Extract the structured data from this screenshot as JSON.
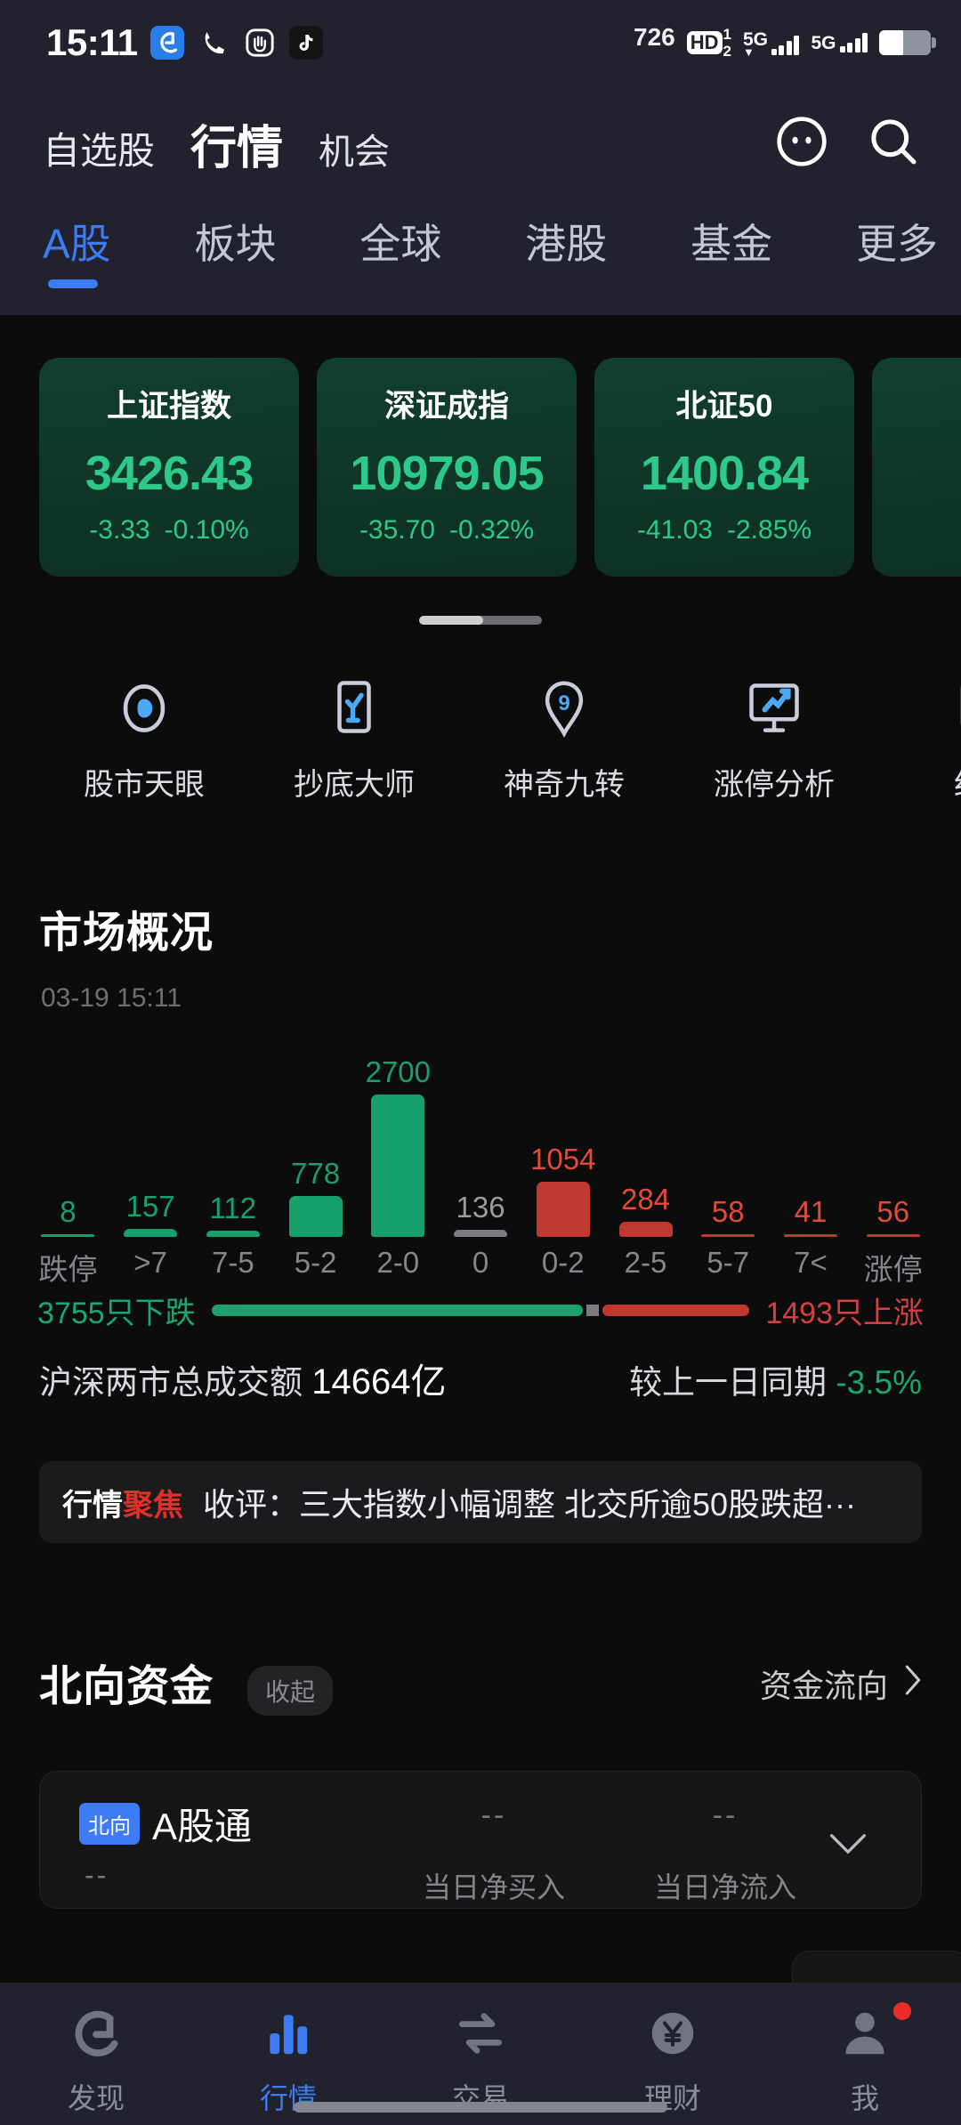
{
  "status_bar": {
    "time": "15:11",
    "app_icons": [
      "finance-app-icon",
      "phone-icon",
      "hand-icon",
      "tiktok-icon"
    ],
    "notification_count": "726",
    "hd_label": "HD",
    "sim1": "1",
    "sim2": "2",
    "network_1": "5G",
    "network_2": "5G"
  },
  "header": {
    "tabs": [
      {
        "label": "自选股",
        "selected": false
      },
      {
        "label": "行情",
        "selected": true
      },
      {
        "label": "机会",
        "selected": false
      }
    ],
    "icons": [
      "emoji-face-icon",
      "search-icon"
    ]
  },
  "category_tabs": [
    {
      "label": "A股",
      "active": true
    },
    {
      "label": "板块",
      "active": false
    },
    {
      "label": "全球",
      "active": false
    },
    {
      "label": "港股",
      "active": false
    },
    {
      "label": "基金",
      "active": false
    },
    {
      "label": "更多",
      "active": false
    }
  ],
  "index_cards": [
    {
      "name": "上证指数",
      "value": "3426.43",
      "change": "-3.33",
      "percent": "-0.10%"
    },
    {
      "name": "深证成指",
      "value": "10979.05",
      "change": "-35.70",
      "percent": "-0.32%"
    },
    {
      "name": "北证50",
      "value": "1400.84",
      "change": "-41.03",
      "percent": "-2.85%"
    }
  ],
  "quick_actions": [
    {
      "label": "股市天眼",
      "icon": "eye-compass-icon"
    },
    {
      "label": "抄底大师",
      "icon": "phone-check-icon"
    },
    {
      "label": "神奇九转",
      "icon": "pin-nine-icon"
    },
    {
      "label": "涨停分析",
      "icon": "monitor-arrow-icon"
    },
    {
      "label": "红绿",
      "icon": "up-arrow-box-icon"
    }
  ],
  "market_overview": {
    "title": "市场概况",
    "timestamp": "03-19 15:11",
    "decliners_text": "3755只下跌",
    "advancers_text": "1493只上涨",
    "decliners": 3755,
    "advancers": 1493,
    "turnover_label": "沪深两市总成交额",
    "turnover_value": "14664亿",
    "compare_label": "较上一日同期",
    "compare_value": "-3.5%"
  },
  "chart_data": {
    "type": "bar",
    "title": "市场概况",
    "subtitle": "03-19 15:11",
    "categories": [
      "跌停",
      ">7",
      "7-5",
      "5-2",
      "2-0",
      "0",
      "0-2",
      "2-5",
      "5-7",
      "7<",
      "涨停"
    ],
    "values": [
      8,
      157,
      112,
      778,
      2700,
      136,
      1054,
      284,
      58,
      41,
      56
    ],
    "bar_colors": [
      "#17a06c",
      "#17a06c",
      "#17a06c",
      "#17a06c",
      "#17a06c",
      "#7a7b80",
      "#c0392f",
      "#c0392f",
      "#c0392f",
      "#c0392f",
      "#c0392f"
    ],
    "label_colors": [
      "#17a06c",
      "#17a06c",
      "#17a06c",
      "#17a06c",
      "#17a06c",
      "#9a9b9f",
      "#e04b3d",
      "#e04b3d",
      "#e04b3d",
      "#e04b3d",
      "#e04b3d"
    ],
    "xlabel": "",
    "ylabel": "",
    "ylim": [
      0,
      2700
    ],
    "grid": false,
    "legend": "none"
  },
  "news": {
    "tag_white": "行情",
    "tag_red": "聚焦",
    "headline": "收评：三大指数小幅调整 北交所逾50股跌超···"
  },
  "northbound": {
    "title": "北向资金",
    "collapse_label": "收起",
    "flow_link": "资金流向",
    "card": {
      "badge": "北向",
      "name": "A股通",
      "value": "--",
      "sub_value": "--",
      "col1_value": "--",
      "col1_label": "当日净买入",
      "col2_value": "--",
      "col2_label": "当日净流入"
    }
  },
  "bottom_nav": [
    {
      "label": "发现",
      "icon": "g-logo-icon",
      "active": false,
      "badge": false
    },
    {
      "label": "行情",
      "icon": "bar-chart-icon",
      "active": true,
      "badge": false
    },
    {
      "label": "交易",
      "icon": "exchange-arrows-icon",
      "active": false,
      "badge": false
    },
    {
      "label": "理财",
      "icon": "yuan-circle-icon",
      "active": false,
      "badge": false
    },
    {
      "label": "我",
      "icon": "person-icon",
      "active": false,
      "badge": true
    }
  ],
  "colors": {
    "green": "#17a06c",
    "red": "#c0392f",
    "accent_blue": "#3e7cf5",
    "bg": "#0c0c0d",
    "chrome": "#21222e"
  }
}
